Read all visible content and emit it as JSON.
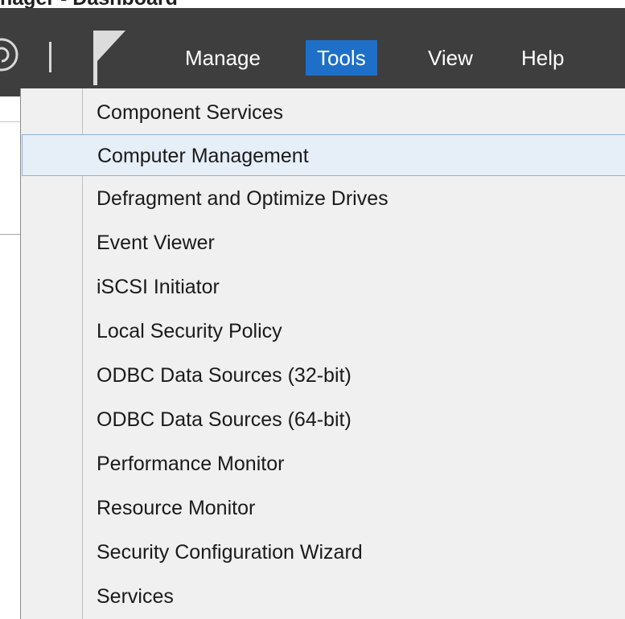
{
  "header": {
    "partial_text": "nager - Dashboard"
  },
  "toolbar": {
    "menus": [
      {
        "label": "Manage",
        "active": false
      },
      {
        "label": "Tools",
        "active": true
      },
      {
        "label": "View",
        "active": false
      },
      {
        "label": "Help",
        "active": false
      }
    ],
    "icons": [
      "refresh-icon",
      "flag-icon"
    ]
  },
  "tools_menu": {
    "highlighted_item": "Computer Management",
    "items": [
      {
        "label": "Component Services"
      },
      {
        "label": "Computer Management"
      },
      {
        "label": "Defragment and Optimize Drives"
      },
      {
        "label": "Event Viewer"
      },
      {
        "label": "iSCSI Initiator"
      },
      {
        "label": "Local Security Policy"
      },
      {
        "label": "ODBC Data Sources (32-bit)"
      },
      {
        "label": "ODBC Data Sources (64-bit)"
      },
      {
        "label": "Performance Monitor"
      },
      {
        "label": "Resource Monitor"
      },
      {
        "label": "Security Configuration Wizard"
      },
      {
        "label": "Services"
      }
    ]
  },
  "colors": {
    "toolbar_bg": "#3e3e3e",
    "menu_active_bg": "#1e6fc8",
    "dropdown_bg": "#f0f0f0",
    "hover_bg": "#e6eef8",
    "hover_border": "#8fb2d8"
  }
}
